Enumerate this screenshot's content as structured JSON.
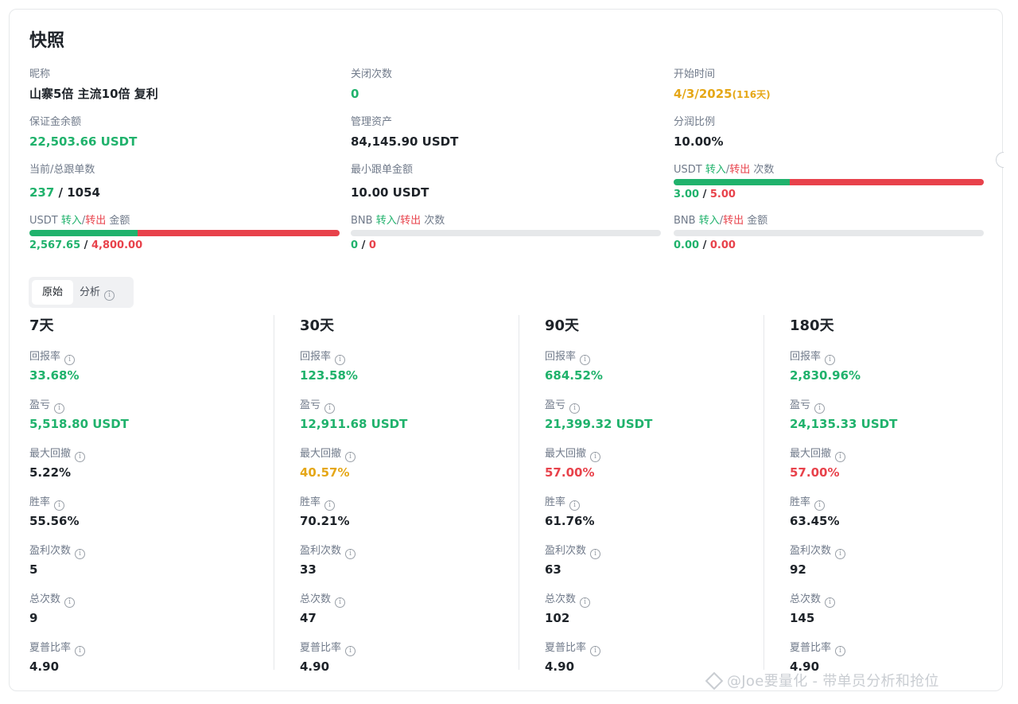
{
  "title": "快照",
  "overview": {
    "nickname": {
      "label": "昵称",
      "value": "山寨5倍 主流10倍 复利"
    },
    "close_count": {
      "label": "关闭次数",
      "value": "0"
    },
    "start_time": {
      "label": "开始时间",
      "value": "4/3/2025",
      "days": "(116天)"
    },
    "margin_balance": {
      "label": "保证金余额",
      "value": "22,503.66 USDT"
    },
    "aum": {
      "label": "管理资产",
      "value": "84,145.90 USDT"
    },
    "profit_share": {
      "label": "分润比例",
      "value": "10.00%"
    },
    "copiers": {
      "label": "当前/总跟单数",
      "current": "237",
      "sep": " / ",
      "total": "1054"
    },
    "min_copy": {
      "label": "最小跟单金额",
      "value": "10.00 USDT"
    },
    "usdt_count": {
      "label_prefix": "USDT ",
      "label_in": "转入",
      "label_slash": "/",
      "label_out": "转出",
      "label_suffix": " 次数",
      "in_value": "3.00",
      "sep": " / ",
      "out_value": "5.00",
      "in_fraction": 0.375
    },
    "usdt_amount": {
      "label_prefix": "USDT ",
      "label_in": "转入",
      "label_slash": "/",
      "label_out": "转出",
      "label_suffix": " 金额",
      "in_value": "2,567.65",
      "sep": " / ",
      "out_value": "4,800.00",
      "in_fraction": 0.348
    },
    "bnb_count": {
      "label_prefix": "BNB ",
      "label_in": "转入",
      "label_slash": "/",
      "label_out": "转出",
      "label_suffix": " 次数",
      "in_value": "0",
      "sep": " / ",
      "out_value": "0",
      "in_fraction": 0
    },
    "bnb_amount": {
      "label_prefix": "BNB ",
      "label_in": "转入",
      "label_slash": "/",
      "label_out": "转出",
      "label_suffix": " 金额",
      "in_value": "0.00",
      "sep": " / ",
      "out_value": "0.00",
      "in_fraction": 0
    }
  },
  "tabs": {
    "raw": "原始",
    "analysis": "分析"
  },
  "info_glyph": "i",
  "metric_labels": {
    "roi": "回报率",
    "pnl": "盈亏",
    "mdd": "最大回撤",
    "win_rate": "胜率",
    "win_count": "盈利次数",
    "total_count": "总次数",
    "sharpe": "夏普比率"
  },
  "periods": [
    {
      "title": "7天",
      "roi": "33.68%",
      "pnl": "5,518.80 USDT",
      "mdd": "5.22%",
      "win_rate": "55.56%",
      "win_count": "5",
      "total_count": "9",
      "sharpe": "4.90"
    },
    {
      "title": "30天",
      "roi": "123.58%",
      "pnl": "12,911.68 USDT",
      "mdd": "40.57%",
      "win_rate": "70.21%",
      "win_count": "33",
      "total_count": "47",
      "sharpe": "4.90"
    },
    {
      "title": "90天",
      "roi": "684.52%",
      "pnl": "21,399.32 USDT",
      "mdd": "57.00%",
      "win_rate": "61.76%",
      "win_count": "63",
      "total_count": "102",
      "sharpe": "4.90"
    },
    {
      "title": "180天",
      "roi": "2,830.96%",
      "pnl": "24,135.33 USDT",
      "mdd": "57.00%",
      "win_rate": "63.45%",
      "win_count": "92",
      "total_count": "145",
      "sharpe": "4.90"
    }
  ],
  "colors": {
    "green": "#20b26c",
    "red": "#e8424b",
    "yellow": "#e5a717",
    "grey_bar": "#e6e8ea"
  },
  "watermark": "@Joe要量化 - 带单员分析和抢位"
}
